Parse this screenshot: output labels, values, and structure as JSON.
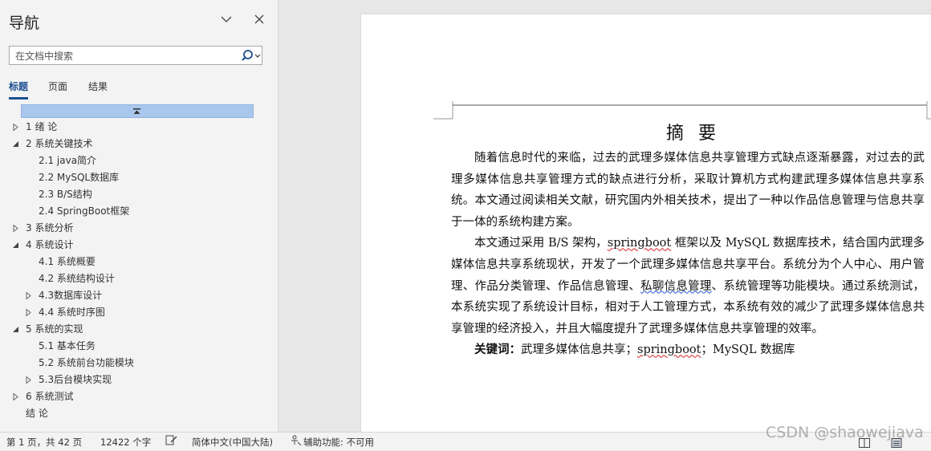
{
  "nav": {
    "title": "导航",
    "search_placeholder": "在文档中搜索",
    "tabs": [
      "标题",
      "页面",
      "结果"
    ],
    "active_tab": "标题",
    "tree": [
      {
        "label": "1 绪  论",
        "level": 1,
        "toggle": "collapsed"
      },
      {
        "label": "2 系统关键技术",
        "level": 1,
        "toggle": "expanded"
      },
      {
        "label": "2.1 java简介",
        "level": 2,
        "toggle": "none"
      },
      {
        "label": "2.2 MySQL数据库",
        "level": 2,
        "toggle": "none"
      },
      {
        "label": "2.3 B/S结构",
        "level": 2,
        "toggle": "none"
      },
      {
        "label": "2.4 SpringBoot框架",
        "level": 2,
        "toggle": "none"
      },
      {
        "label": "3 系统分析",
        "level": 1,
        "toggle": "collapsed"
      },
      {
        "label": "4 系统设计",
        "level": 1,
        "toggle": "expanded"
      },
      {
        "label": "4.1 系统概要",
        "level": 2,
        "toggle": "none"
      },
      {
        "label": "4.2 系统结构设计",
        "level": 2,
        "toggle": "none"
      },
      {
        "label": "4.3数据库设计",
        "level": 2,
        "toggle": "collapsed"
      },
      {
        "label": "4.4 系统时序图",
        "level": 2,
        "toggle": "collapsed"
      },
      {
        "label": "5 系统的实现",
        "level": 1,
        "toggle": "expanded"
      },
      {
        "label": "5.1 基本任务",
        "level": 2,
        "toggle": "none"
      },
      {
        "label": "5.2 系统前台功能模块",
        "level": 2,
        "toggle": "none"
      },
      {
        "label": "5.3后台模块实现",
        "level": 2,
        "toggle": "collapsed"
      },
      {
        "label": "6 系统测试",
        "level": 1,
        "toggle": "collapsed"
      },
      {
        "label": "结  论",
        "level": 1,
        "toggle": "none"
      }
    ]
  },
  "document": {
    "abstract_title": "摘要",
    "para1": "随着信息时代的来临，过去的武理多媒体信息共享管理方式缺点逐渐暴露，对过去的武理多媒体信息共享管理方式的缺点进行分析，采取计算机方式构建武理多媒体信息共享系统。本文通过阅读相关文献，研究国内外相关技术，提出了一种以作品信息管理与信息共享于一体的系统构建方案。",
    "para2_a": "本文通过采用 B/S 架构，",
    "para2_sb": "springboot",
    "para2_b": " 框架以及 MySQL 数据库技术，结合国内武理多媒体信息共享系统现状，开发了一个武理多媒体信息共享平台。系统分为个人中心、用户管理、作品分类管理、作品信息管理、",
    "para2_chat": "私聊信息管理",
    "para2_c": "、系统管理等功能模块。通过系统测试，本系统实现了系统设计目标，相对于人工管理方式，本系统有效的减少了武理多媒体信息共享管理的经济投入，并且大幅度提升了武理多媒体信息共享管理的效率。",
    "keywords_label": "关键词：",
    "keywords_a": "武理多媒体信息共享；",
    "keywords_sb": "springboot",
    "keywords_b": "；MySQL 数据库"
  },
  "status": {
    "page": "第 1 页，共 42 页",
    "words": "12422 个字",
    "language": "简体中文(中国大陆)",
    "accessibility": "辅助功能: 不可用"
  },
  "watermark": "CSDN @shaowejiava"
}
